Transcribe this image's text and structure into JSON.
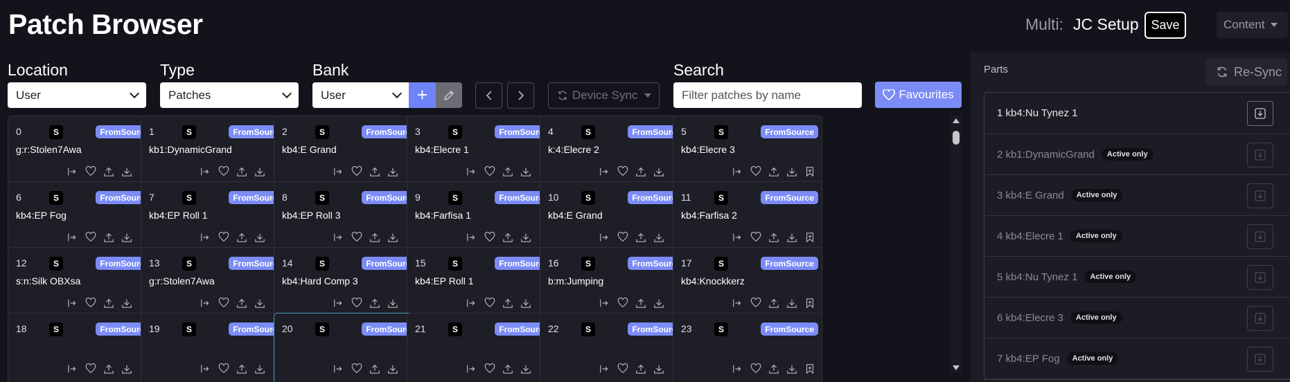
{
  "header": {
    "title": "Patch Browser",
    "multi_label": "Multi:",
    "multi_name": "JC Setup",
    "save_label": "Save",
    "content_label": "Content"
  },
  "filters": {
    "location": {
      "label": "Location",
      "value": "User"
    },
    "type": {
      "label": "Type",
      "value": "Patches"
    },
    "bank": {
      "label": "Bank",
      "value": "User",
      "add_label": "+"
    },
    "device_sync_label": "Device Sync",
    "search": {
      "label": "Search",
      "placeholder": "Filter patches by name"
    },
    "favourites_label": "Favourites"
  },
  "patches": [
    {
      "num": "0",
      "name": "g:r:Stolen7Awa",
      "s": "S",
      "tag": "FromSource"
    },
    {
      "num": "1",
      "name": "kb1:DynamicGrand",
      "s": "S",
      "tag": "FromSource"
    },
    {
      "num": "2",
      "name": "kb4:E Grand",
      "s": "S",
      "tag": "FromSource"
    },
    {
      "num": "3",
      "name": "kb4:Elecre 1",
      "s": "S",
      "tag": "FromSource"
    },
    {
      "num": "4",
      "name": "k:4:Elecre 2",
      "s": "S",
      "tag": "FromSource"
    },
    {
      "num": "5",
      "name": "kb4:Elecre 3",
      "s": "S",
      "tag": "FromSource"
    },
    {
      "num": "6",
      "name": "kb4:EP Fog",
      "s": "S",
      "tag": "FromSource"
    },
    {
      "num": "7",
      "name": "kb4:EP Roll 1",
      "s": "S",
      "tag": "FromSource"
    },
    {
      "num": "8",
      "name": "kb4:EP Roll 3",
      "s": "S",
      "tag": "FromSource"
    },
    {
      "num": "9",
      "name": "kb4:Farfisa 1",
      "s": "S",
      "tag": "FromSource"
    },
    {
      "num": "10",
      "name": "kb4:E Grand",
      "s": "S",
      "tag": "FromSource"
    },
    {
      "num": "11",
      "name": "kb4:Farfisa 2",
      "s": "S",
      "tag": "FromSource"
    },
    {
      "num": "12",
      "name": "s:n:Silk OBXsa",
      "s": "S",
      "tag": "FromSource"
    },
    {
      "num": "13",
      "name": "g:r:Stolen7Awa",
      "s": "S",
      "tag": "FromSource"
    },
    {
      "num": "14",
      "name": "kb4:Hard Comp 3",
      "s": "S",
      "tag": "FromSource"
    },
    {
      "num": "15",
      "name": "kb4:EP Roll 1",
      "s": "S",
      "tag": "FromSource"
    },
    {
      "num": "16",
      "name": "b:m:Jumping",
      "s": "S",
      "tag": "FromSource"
    },
    {
      "num": "17",
      "name": "kb4:Knockkerz",
      "s": "S",
      "tag": "FromSource"
    },
    {
      "num": "18",
      "name": "",
      "s": "S",
      "tag": "FromSource"
    },
    {
      "num": "19",
      "name": "",
      "s": "S",
      "tag": "FromSource"
    },
    {
      "num": "20",
      "name": "",
      "s": "S",
      "tag": "FromSource",
      "selected": true
    },
    {
      "num": "21",
      "name": "",
      "s": "S",
      "tag": "FromSource"
    },
    {
      "num": "22",
      "name": "",
      "s": "S",
      "tag": "FromSource"
    },
    {
      "num": "23",
      "name": "",
      "s": "S",
      "tag": "FromSource"
    }
  ],
  "parts": {
    "label": "Parts",
    "resync_label": "Re-Sync",
    "items": [
      {
        "label": "1 kb4:Nu Tynez 1",
        "badge": "",
        "active": true
      },
      {
        "label": "2 kb1:DynamicGrand",
        "badge": "Active only"
      },
      {
        "label": "3 kb4:E Grand",
        "badge": "Active only"
      },
      {
        "label": "4 kb4:Elecre 1",
        "badge": "Active only"
      },
      {
        "label": "5 kb4:Nu Tynez 1",
        "badge": "Active only"
      },
      {
        "label": "6 kb4:Elecre 3",
        "badge": "Active only"
      },
      {
        "label": "7 kb4:EP Fog",
        "badge": "Active only"
      }
    ]
  }
}
